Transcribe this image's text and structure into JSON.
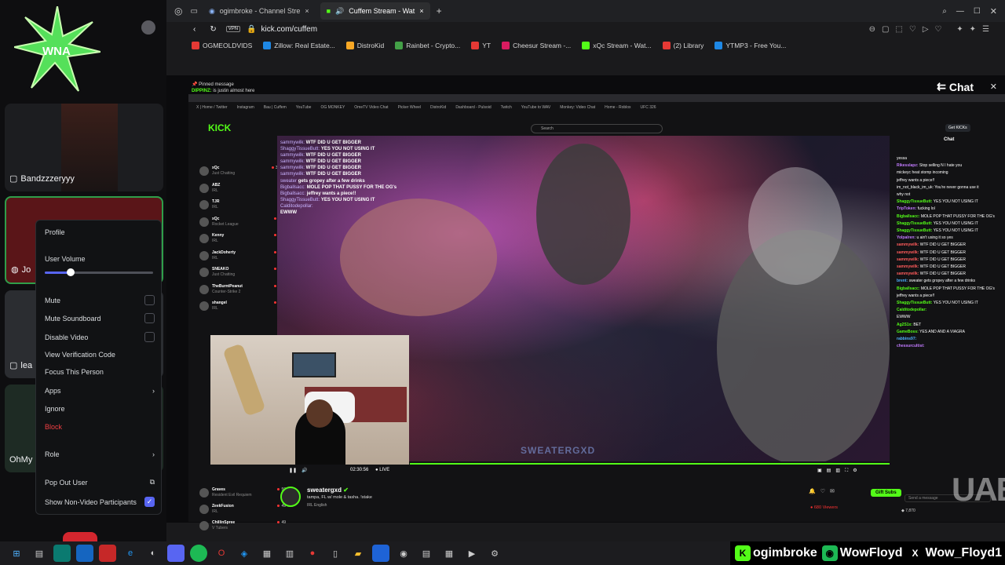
{
  "discord": {
    "logo_text": "WNA",
    "tiles": [
      {
        "name": "Bandzzzeryyy"
      },
      {
        "name": "Jo"
      },
      {
        "name": "lea"
      },
      {
        "name": "OhMy"
      }
    ],
    "context_menu": {
      "profile": "Profile",
      "user_volume": "User Volume",
      "user_volume_level": 0.24,
      "mute": "Mute",
      "mute_soundboard": "Mute Soundboard",
      "disable_video": "Disable Video",
      "view_verification": "View Verification Code",
      "focus": "Focus This Person",
      "apps": "Apps",
      "ignore": "Ignore",
      "block": "Block",
      "role": "Role",
      "pop_out": "Pop Out User",
      "show_non_video": "Show Non-Video Participants"
    }
  },
  "browser": {
    "tabs": [
      {
        "label": "ogimbroke - Channel Stre",
        "active": false
      },
      {
        "label": "Cuffem Stream - Wat",
        "active": true
      }
    ],
    "url": "kick.com/cuffem",
    "bookmarks": [
      {
        "label": "OGMEOLDVIDS",
        "color": "#e53935"
      },
      {
        "label": "Zillow: Real Estate...",
        "color": "#1e88e5"
      },
      {
        "label": "DistroKid",
        "color": "#f9a825"
      },
      {
        "label": "Rainbet - Crypto...",
        "color": "#43a047"
      },
      {
        "label": "YT",
        "color": "#e53935"
      },
      {
        "label": "Cheesur Stream -...",
        "color": "#d81b60"
      },
      {
        "label": "xQc Stream - Wat...",
        "color": "#53fc18"
      },
      {
        "label": "(2) Library",
        "color": "#e53935"
      },
      {
        "label": "YTMP3 - Free You...",
        "color": "#1e88e5"
      }
    ],
    "chat_button": "Chat",
    "pinned": "Pinned message",
    "pinned_text": "is justin almost here"
  },
  "stream": {
    "kick_logo": "KICK",
    "search_placeholder": "Search",
    "get_kicks": "Get KICKs",
    "following": [
      {
        "name": "xQc",
        "game": "Just Chatting",
        "viewers": "34.4K"
      },
      {
        "name": "ABZ",
        "game": "IRL",
        "viewers": "8K"
      },
      {
        "name": "TJR",
        "game": "IRL",
        "viewers": "7K"
      },
      {
        "name": "xQc",
        "game": "Rocket League",
        "viewers": "6.5K"
      },
      {
        "name": "Kenny",
        "game": "IRL",
        "viewers": "4.8K"
      },
      {
        "name": "JackDoherty",
        "game": "IRL",
        "viewers": "4.4K"
      },
      {
        "name": "SNEAKO",
        "game": "Just Chatting",
        "viewers": "3.3K"
      },
      {
        "name": "TheBurntPeanut",
        "game": "Counter-Strike 2",
        "viewers": "2.3K"
      },
      {
        "name": "shangel",
        "game": "IRL",
        "viewers": "1.7K"
      },
      {
        "name": "Graves",
        "game": "Resident Evil Requiem",
        "viewers": "50"
      },
      {
        "name": "ZeekFusion",
        "game": "IRL",
        "viewers": "49"
      },
      {
        "name": "ChillinSpree",
        "game": "V Tubers",
        "viewers": "49"
      }
    ],
    "overlay_chat": [
      {
        "user": "sammywilk:",
        "msg": "WTF DID U GET BIGGER"
      },
      {
        "user": "ShaggyTissueButt:",
        "msg": "YES YOU NOT USING IT"
      },
      {
        "user": "sammywilk:",
        "msg": "WTF DID U GET BIGGER"
      },
      {
        "user": "sammywilk:",
        "msg": "WTF DID U GET BIGGER"
      },
      {
        "user": "sammywilk:",
        "msg": "WTF DID U GET BIGGER"
      },
      {
        "user": "sammywilk:",
        "msg": "WTF DID U GET BIGGER"
      },
      {
        "user": "sweater",
        "msg": "gets gropey after a few drinks"
      },
      {
        "user": "Bigballsacc:",
        "msg": "MOLE POP THAT PUSSY FOR THE OG's"
      },
      {
        "user": "Bigballsacc:",
        "msg": "jeffrey wants a piece!!"
      },
      {
        "user": "ShaggyTissueButt:",
        "msg": "YES YOU NOT USING IT"
      },
      {
        "user": "Calditodepollar:",
        "msg": ""
      },
      {
        "user": "",
        "msg": "EWWW"
      }
    ],
    "time": "02:30:56",
    "live": "LIVE",
    "watermark": "SWEATERGXD",
    "channel_name": "sweatergxd",
    "channel_title": "tampa, FL w/ mole & tasha. !stake",
    "tags": "IRL   English",
    "gift_subs": "Gift Subs",
    "viewers": "680 Viewers",
    "chat_title": "Chat",
    "chat_lines": [
      {
        "user": "",
        "msg": "yessa",
        "c": "p"
      },
      {
        "user": "Rikesslapz:",
        "msg": "Stop selling N I hate you",
        "c": "p"
      },
      {
        "user": "",
        "msg": "mickeyc heat stomp incoming",
        "c": "b"
      },
      {
        "user": "",
        "msg": "jeffrey wants a piece!!",
        "c": "r"
      },
      {
        "user": "",
        "msg": "im_not_black_im_uk: You're never gonna use it",
        "c": "b"
      },
      {
        "user": "",
        "msg": "why not",
        "c": "b"
      },
      {
        "user": "ShaggyTissueButt:",
        "msg": "YES YOU NOT USING IT",
        "c": "g"
      },
      {
        "user": "TripToken:",
        "msg": "fucking lol",
        "c": "p"
      },
      {
        "user": "Bigballsacc:",
        "msg": "MOLE POP THAT PUSSY FOR THE OG's",
        "c": "g"
      },
      {
        "user": "ShaggyTissueButt:",
        "msg": "YES YOU NOT USING IT",
        "c": "g"
      },
      {
        "user": "ShaggyTissueButt:",
        "msg": "YES YOU NOT USING IT",
        "c": "g"
      },
      {
        "user": "Yolpalren:",
        "msg": "u ain't using it so yes",
        "c": "p"
      },
      {
        "user": "sammywilk:",
        "msg": "WTF DID U GET BIGGER",
        "c": "r"
      },
      {
        "user": "sammywilk:",
        "msg": "WTF DID U GET BIGGER",
        "c": "r"
      },
      {
        "user": "sammywilk:",
        "msg": "WTF DID U GET BIGGER",
        "c": "r"
      },
      {
        "user": "sammywilk:",
        "msg": "WTF DID U GET BIGGER",
        "c": "r"
      },
      {
        "user": "sammywilk:",
        "msg": "WTF DID U GET BIGGER",
        "c": "r"
      },
      {
        "user": "brent:",
        "msg": "sweater gets gropey after a few drinks",
        "c": "b"
      },
      {
        "user": "Bigballsacc:",
        "msg": "MOLE POP THAT PUSSY FOR THE OG's",
        "c": "g"
      },
      {
        "user": "",
        "msg": "jeffrey wants a piece!!",
        "c": "r"
      },
      {
        "user": "ShaggyTissueButt:",
        "msg": "YES YOU NOT USING IT",
        "c": "g"
      },
      {
        "user": "Calditodepollar:",
        "msg": "",
        "c": "g"
      },
      {
        "user": "",
        "msg": "EWWW",
        "c": "r"
      },
      {
        "user": "Ag2S1x:",
        "msg": "BET",
        "c": "g"
      },
      {
        "user": "GameBoss:",
        "msg": "YES AND AND A VIAGRA",
        "c": "g"
      },
      {
        "user": "rabbins97:",
        "msg": "",
        "c": "b"
      },
      {
        "user": "chessurcultist:",
        "msg": "",
        "c": "p"
      }
    ],
    "send_placeholder": "Send a message",
    "chat_count": "7,870"
  },
  "overlay_socials": [
    {
      "handle": "ogimbroke",
      "icon": "kick-icon",
      "color": "#53fc18"
    },
    {
      "handle": "WowFloyd",
      "icon": "spotify-icon",
      "color": "#1db954"
    },
    {
      "handle": "Wow_Floyd1",
      "icon": "x-icon",
      "color": "#000000"
    }
  ],
  "corner_logo": "UAB"
}
